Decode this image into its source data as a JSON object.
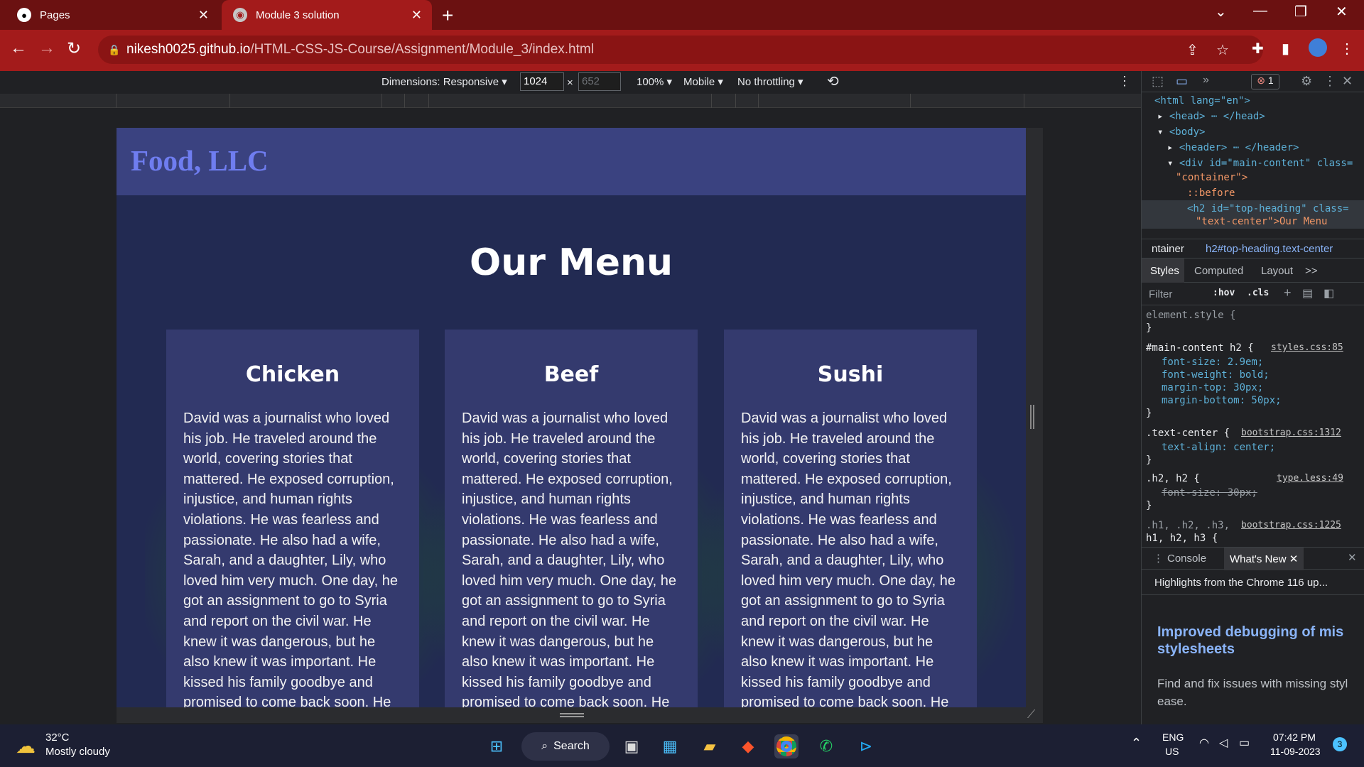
{
  "browser": {
    "tabs": [
      {
        "label": "Pages",
        "icon": "github-icon"
      },
      {
        "label": "Module 3 solution",
        "icon": "globe-icon"
      }
    ],
    "close_glyph": "✕",
    "new_tab_glyph": "+",
    "url_host": "nikesh0025.github.io",
    "url_path": "/HTML-CSS-JS-Course/Assignment/Module_3/index.html",
    "accent": "#a31b1b"
  },
  "device_toolbar": {
    "dimensions_label": "Dimensions: Responsive ▾",
    "width_value": "1024",
    "times": "×",
    "height_placeholder": "652",
    "zoom": "100% ▾",
    "device": "Mobile ▾",
    "throttling": "No throttling ▾"
  },
  "site": {
    "title": "Food, LLC",
    "heading": "Our Menu",
    "cards": [
      {
        "name": "Chicken",
        "text": "David was a journalist who loved his job. He traveled around the world, covering stories that mattered. He exposed corruption, injustice, and human rights violations. He was fearless and passionate. He also had a wife, Sarah, and a daughter, Lily, who loved him very much. One day, he got an assignment to go to Syria and report on the civil war. He knew it was dangerous, but he also knew it was important. He kissed his family goodbye and promised to come back soon. He boarded a plane and flew to Damascus. He met"
      },
      {
        "name": "Beef",
        "text": "David was a journalist who loved his job. He traveled around the world, covering stories that mattered. He exposed corruption, injustice, and human rights violations. He was fearless and passionate. He also had a wife, Sarah, and a daughter, Lily, who loved him very much. One day, he got an assignment to go to Syria and report on the civil war. He knew it was dangerous, but he also knew it was important. He kissed his family goodbye and promised to come back soon. He boarded a plane and flew to Damascus. He met"
      },
      {
        "name": "Sushi",
        "text": "David was a journalist who loved his job. He traveled around the world, covering stories that mattered. He exposed corruption, injustice, and human rights violations. He was fearless and passionate. He also had a wife, Sarah, and a daughter, Lily, who loved him very much. One day, he got an assignment to go to Syria and report on the civil war. He knew it was dangerous, but he also knew it was important. He kissed his family goodbye and promised to come back soon. He boarded a plane and flew to Damascus. He met"
      }
    ]
  },
  "devtools": {
    "error_count": "1",
    "dom": {
      "l1": "<html lang=\"en\">",
      "l2": "<head> ⋯ </head>",
      "l3": "<body>",
      "l4": "<header> ⋯ </header>",
      "l5": "<div id=\"main-content\" class=",
      "l6": "\"container\">",
      "l7": "::before",
      "l8": "<h2 id=\"top-heading\" class=",
      "l9": "\"text-center\">Our Menu"
    },
    "breadcrumb_left": "ntainer",
    "breadcrumb_right": "h2#top-heading.text-center",
    "tabs": {
      "styles": "Styles",
      "computed": "Computed",
      "layout": "Layout",
      "more": ">>"
    },
    "filter_placeholder": "Filter",
    "hov": ":hov",
    "cls": ".cls",
    "rules": {
      "r1_sel": "element.style {",
      "close": "}",
      "r2_sel": "#main-content h2 {",
      "r2_src": "styles.css:85",
      "r2_p1": "font-size: 2.9em;",
      "r2_p2": "font-weight: bold;",
      "r2_p3": "margin-top: 30px;",
      "r2_p4": "margin-bottom: 50px;",
      "r3_sel": ".text-center {",
      "r3_src": "bootstrap.css:1312",
      "r3_p1": "text-align: center;",
      "r4_sel": ".h2, h2 {",
      "r4_src": "type.less:49",
      "r4_p1": "font-size: 30px;",
      "r5_sel": ".h1, .h2, .h3,",
      "r5_src": "bootstrap.css:1225",
      "r5_sel2": "h1, h2, h3 {"
    },
    "console_tab": "Console",
    "whatsnew_tab": "What's New",
    "highlights": "Highlights from the Chrome 116 up...",
    "wn_title": "Improved debugging of mis stylesheets",
    "wn_body": "Find and fix issues with missing styl ease."
  },
  "taskbar": {
    "weather_temp": "32°C",
    "weather_desc": "Mostly cloudy",
    "search_label": "Search",
    "lang1": "ENG",
    "lang2": "US",
    "time": "07:42 PM",
    "date": "11-09-2023",
    "notif_count": "3"
  }
}
